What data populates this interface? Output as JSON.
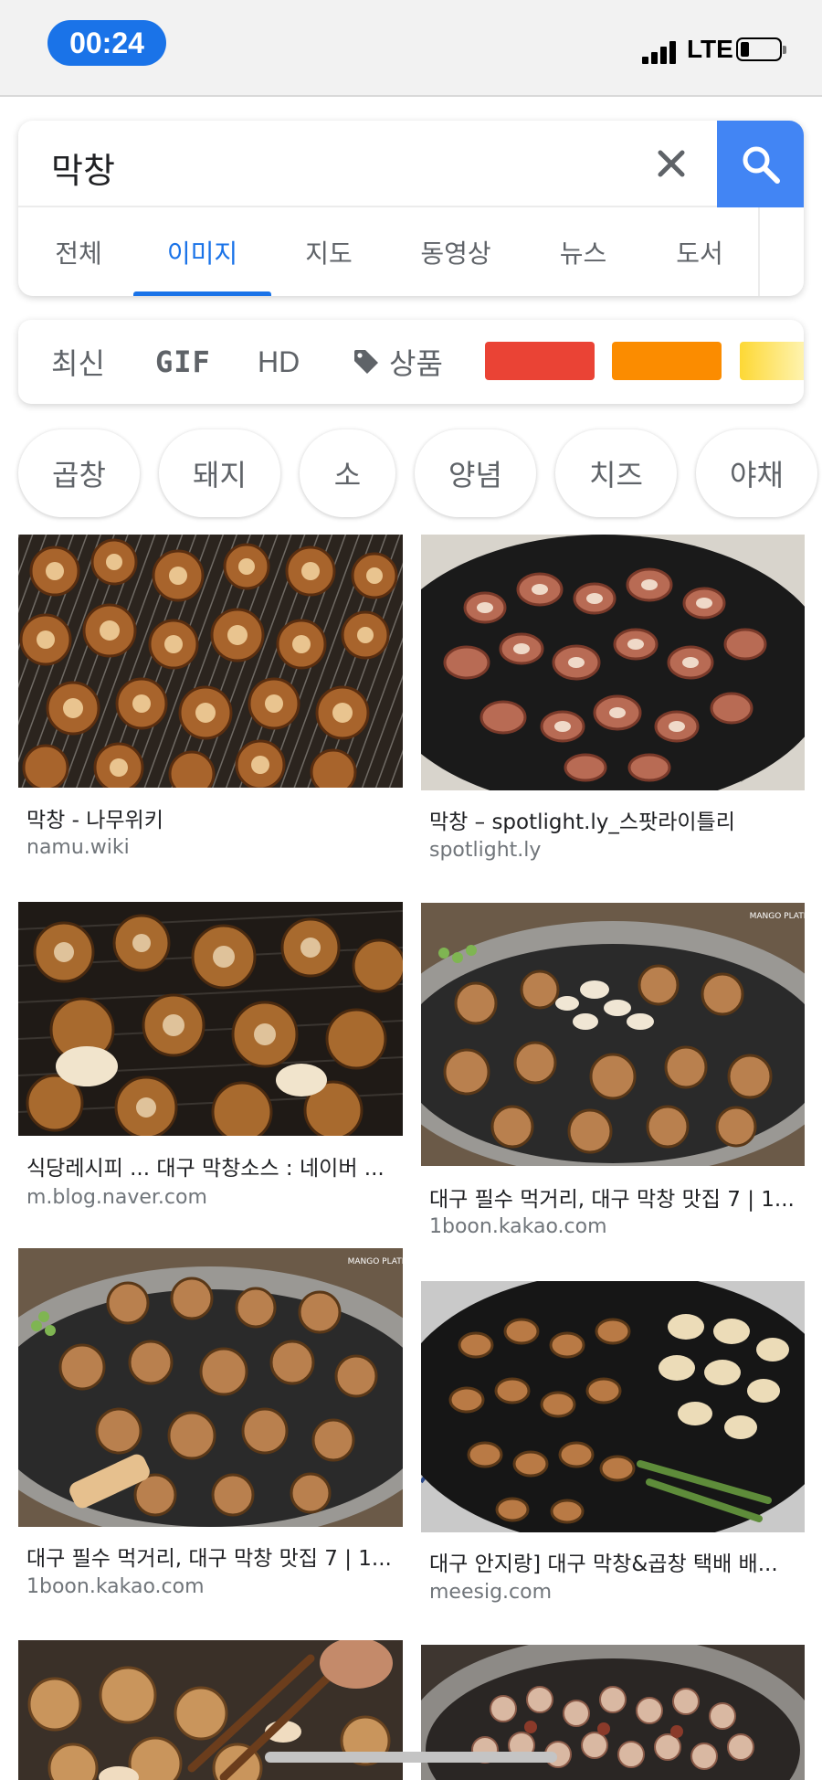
{
  "status_bar": {
    "time": "00:24",
    "network": "LTE",
    "accent": "#1a73e8"
  },
  "search": {
    "query": "막창",
    "clear_icon": "close-icon",
    "search_icon": "search-icon",
    "button_color": "#4285f4"
  },
  "tabs": [
    {
      "label": "전체"
    },
    {
      "label": "이미지",
      "active": true
    },
    {
      "label": "지도"
    },
    {
      "label": "동영상"
    },
    {
      "label": "뉴스"
    },
    {
      "label": "도서"
    }
  ],
  "filters": {
    "latest": "최신",
    "gif": "GIF",
    "hd": "HD",
    "product": "상품",
    "product_icon": "tag-icon",
    "colors": [
      "#ea4335",
      "#fb8c00",
      "#fdd835"
    ]
  },
  "chips": [
    "곱창",
    "돼지",
    "소",
    "양념",
    "치즈",
    "야채"
  ],
  "results": [
    {
      "title": "막창 - 나무위키",
      "source": "namu.wiki"
    },
    {
      "title": "막창 – spotlight.ly_스팟라이틀리",
      "source": "spotlight.ly"
    },
    {
      "title": "식당레시피 ... 대구 막창소스 : 네이버 ...",
      "source": "m.blog.naver.com"
    },
    {
      "title": "대구 필수 먹거리, 대구 막창 맛집 7 | 1...",
      "source": "1boon.kakao.com",
      "watermark": "MANGO PLATE"
    },
    {
      "title": "대구 필수 먹거리, 대구 막창 맛집 7 | 1...",
      "source": "1boon.kakao.com",
      "watermark": "MANGO PLATE"
    },
    {
      "title": "대구 안지랑] 대구 막창&곱창 택배 배...",
      "source": "meesig.com"
    },
    {
      "title": "",
      "source": ""
    },
    {
      "title": "",
      "source": ""
    }
  ]
}
